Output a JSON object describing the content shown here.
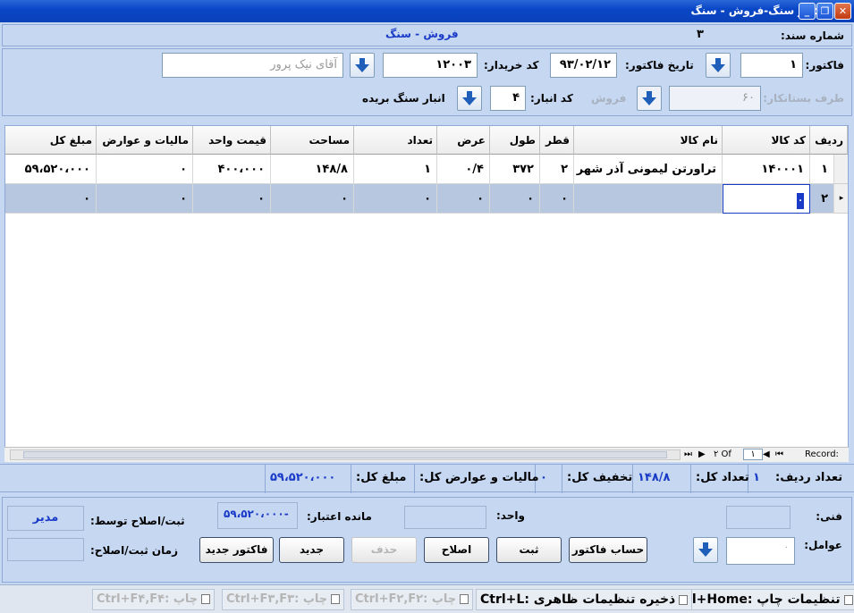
{
  "window": {
    "title": "فاکتور سنگ-فروش - سنگ"
  },
  "header": {
    "doc_number_label": "شماره سند:",
    "doc_number_value": "۳",
    "doc_type": "فروش - سنگ"
  },
  "form": {
    "invoice_label": "فاکتور:",
    "invoice_value": "۱",
    "invoice_date_label": "تاریخ فاکتور:",
    "invoice_date_value": "۹۳/۰۲/۱۲",
    "buyer_code_label": "کد خریدار:",
    "buyer_code_value": "۱۲۰۰۳",
    "buyer_name_value": "آقای نیک پرور",
    "creditor_label": "طرف بستانکار:",
    "creditor_value": "۶۰",
    "sale_label": "فروش",
    "warehouse_code_label": "کد انبار:",
    "warehouse_code_value": "۴",
    "warehouse_name": "انبار سنگ بریده"
  },
  "grid": {
    "columns": [
      "ردیف",
      "کد کالا",
      "نام کالا",
      "قطر",
      "طول",
      "عرض",
      "تعداد",
      "مساحت",
      "قیمت واحد",
      "مالیات و عوارض",
      "مبلغ کل"
    ],
    "rows": [
      [
        "۱",
        "۱۴۰۰۰۱",
        "تراورتن لیمونی آذر شهر",
        "۲",
        "۳۷۲",
        "۰/۴",
        "۱",
        "۱۴۸/۸",
        "۴۰۰،۰۰۰",
        "۰",
        "۵۹،۵۲۰،۰۰۰"
      ],
      [
        "۲",
        "۰",
        "",
        "۰",
        "۰",
        "۰",
        "۰",
        "۰",
        "۰",
        "۰",
        "۰"
      ]
    ],
    "nav_record": "Record:",
    "nav_of": "۲ Of",
    "nav_current": "۱"
  },
  "summary": {
    "row_count_label": "تعداد ردیف:",
    "row_count_value": "۱",
    "total_count_label": "تعداد کل:",
    "total_count_value": "۱۴۸/۸",
    "discount_label": "تخفیف کل:",
    "discount_value": "۰",
    "tax_label": "مالیات و عوارض کل:",
    "total_amount_label": "مبلغ کل:",
    "total_amount_value": "۵۹،۵۲۰،۰۰۰"
  },
  "footer": {
    "technical_label": "فنی:",
    "unit_label": "واحد:",
    "credit_remaining_label": "مانده اعتبار:",
    "credit_remaining_value": "-۵۹،۵۲۰،۰۰۰",
    "registered_by_label": "ثبت/اصلاح توسط:",
    "registered_by_value": "مدیر",
    "factors_label": "عوامل:",
    "factors_value": "۰",
    "register_time_label": "زمان ثبت/اصلاح:"
  },
  "buttons": {
    "invoice_calc": "حساب فاکتور",
    "save": "ثبت",
    "edit": "اصلاح",
    "delete": "حذف",
    "new": "جدید",
    "new_invoice": "فاکتور جدید"
  },
  "statusbar": {
    "print_settings": "تنظیمات چاپ :Ctrl+Home",
    "save_view": "ذخیره تنظیمات ظاهری :Ctrl+L",
    "print1": "چاپ :Ctrl+F۲,F۲",
    "print2": "چاپ :Ctrl+F۳,F۳",
    "print3": "چاپ :Ctrl+F۴,F۴"
  },
  "colors": {
    "accent_blue": "#1a3ac8",
    "title_blue": "#0a47c7",
    "selected_row": "#b8c7e0"
  }
}
